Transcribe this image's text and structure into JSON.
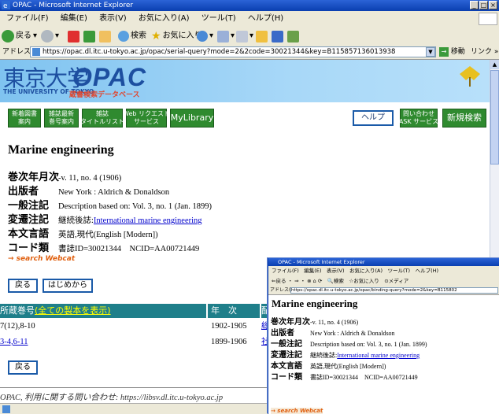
{
  "window": {
    "title": "OPAC - Microsoft Internet Explorer",
    "menu": [
      "ファイル(F)",
      "編集(E)",
      "表示(V)",
      "お気に入り(A)",
      "ツール(T)",
      "ヘルプ(H)"
    ],
    "toolbar": {
      "back": "戻る",
      "search": "検索",
      "favorites": "お気に入り"
    },
    "address_label": "アドレス(D)",
    "address": "https://opac.dl.itc.u-tokyo.ac.jp/opac/serial-query?mode=2&2code=30021344&key=B115857136013938",
    "go": "移動",
    "links": "リンク »"
  },
  "banner": {
    "ja": "東京大学",
    "opac": "OPAC",
    "en": "THE UNIVERSITY OF TOKYO",
    "sub": "蔵書検索データベース"
  },
  "nav": {
    "new_books": "新着図書\n案内",
    "new_serials": "雑誌最新\n巻号案内",
    "serial_title_list": "雑誌\nタイトルリスト",
    "web_request": "Web リクエスト\nサービス",
    "mylibrary": "MyLibrary",
    "help": "ヘルプ",
    "ask": "問い合わせ\nASK サービス",
    "new_search": "新規検索"
  },
  "record": {
    "title": "Marine engineering",
    "fields": [
      {
        "label": "巻次年月次",
        "value": "-v. 11, no. 4 (1906)"
      },
      {
        "label": "出版者",
        "value": "New York : Aldrich & Donaldson"
      },
      {
        "label": "一般注記",
        "value": "Description based on: Vol. 3, no. 1 (Jan. 1899)"
      },
      {
        "label": "変遷注記",
        "prefix": "継続後誌:",
        "value": "International marine engineering"
      },
      {
        "label": "本文言語",
        "value": "英語,現代(English [Modern])"
      },
      {
        "label": "コード類",
        "value": "書誌ID=30021344　NCID=AA00721449"
      }
    ],
    "webcat": "→ search Webcat"
  },
  "buttons": {
    "back": "戻る",
    "home": "はじめから",
    "back2": "戻る"
  },
  "holdings": {
    "col_volume": "所蔵巻号",
    "show_all": "(全ての製本を表示)",
    "col_year": "年　次",
    "col_more": "配",
    "rows": [
      {
        "volume": "7(12),8-10",
        "years": "1902-1905",
        "extra": "総"
      },
      {
        "volume": "3-4,6-11",
        "years": "1899-1906",
        "extra": "社"
      }
    ]
  },
  "footer": "OPAC, 利用に関する問い合わせ:  https://libsv.dl.itc.u-tokyo.ac.jp",
  "window2": {
    "title": "OPAC - Microsoft Internet Explorer",
    "menu": "ファイル(F)　編集(E)　表示(V)　お気に入り(A)　ツール(T)　ヘルプ(H)",
    "toolbar": "⇐戻る ・ ⇒ ・ ⊗ ⌂ ⟳　🔍検索　☆お気に入り　⊙メディア",
    "address_label": "アドレス(D)",
    "address": "https://opac.dl.itc.u-tokyo.ac.jp/opac/binding-query?mode=2&key=B115802",
    "title_text": "Marine engineering",
    "fields": [
      {
        "label": "巻次年月次",
        "value": "-v. 11, no. 4 (1906)"
      },
      {
        "label": "出版者",
        "value": "New York : Aldrich & Donaldson"
      },
      {
        "label": "一般注記",
        "value": "Description based on: Vol. 3, no. 1 (Jan. 1899)"
      },
      {
        "label": "変遷注記",
        "prefix": "継続後誌:",
        "value": "International marine engineering"
      },
      {
        "label": "本文言語",
        "value": "英語,現代(English [Modern])"
      },
      {
        "label": "コード類",
        "value": "書誌ID=30021344　NCID=AA00721449"
      }
    ],
    "webcat": "→ search Webcat"
  },
  "colors": {
    "nav_green": "#2f8a2f",
    "table_head": "#1f7f8a",
    "link": "#0000cc",
    "banner": "#a8d8f8"
  }
}
